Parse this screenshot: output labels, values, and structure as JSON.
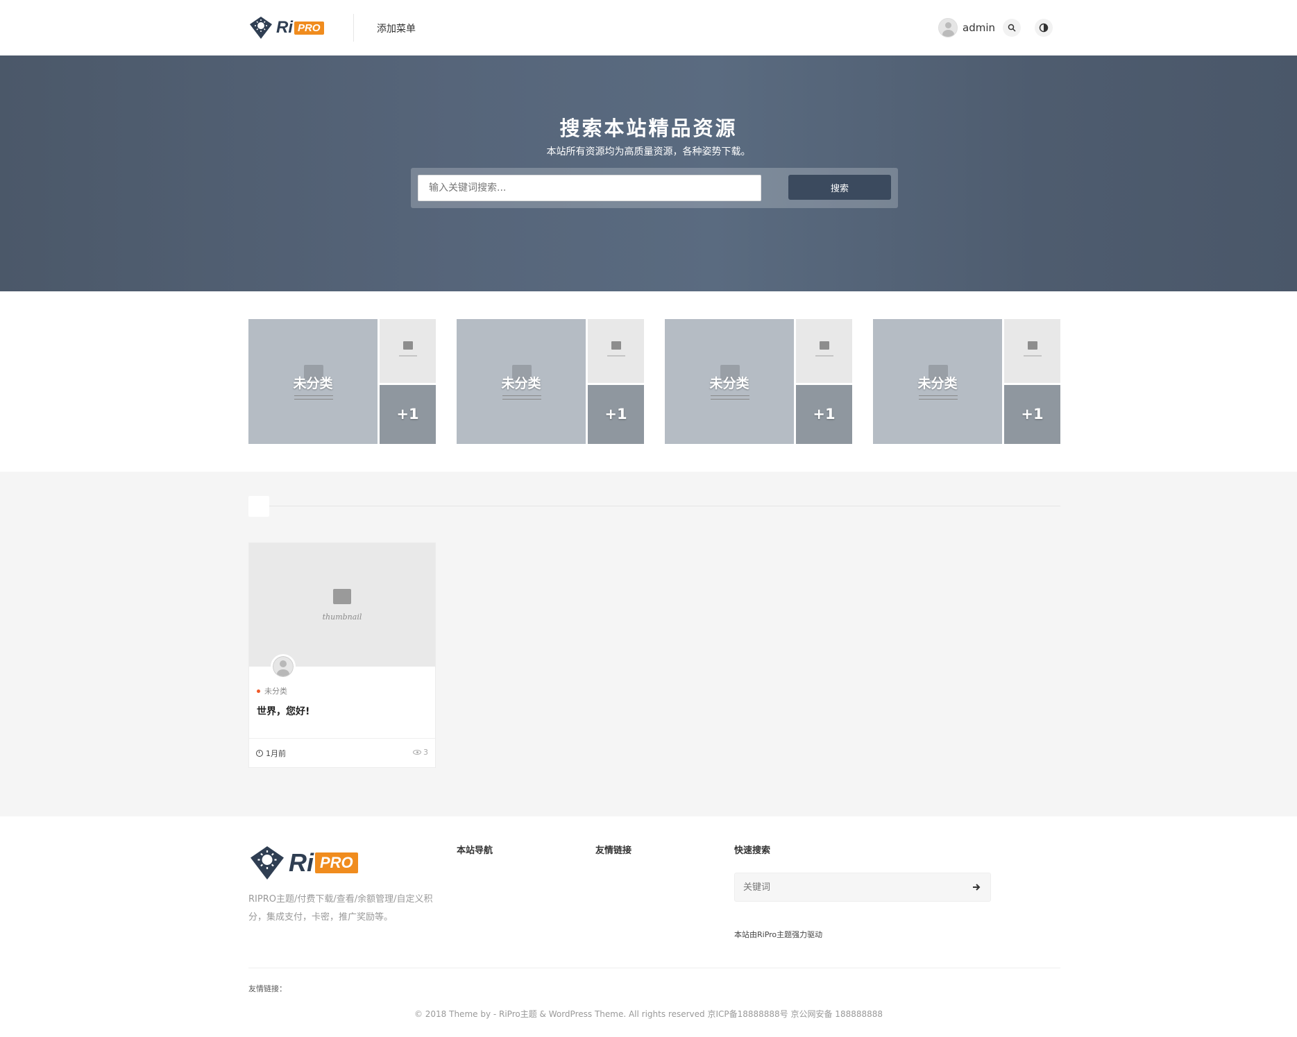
{
  "header": {
    "logo_ri": "Ri",
    "logo_pro": "PRO",
    "menu_item": "添加菜单",
    "user_name": "admin",
    "icons": [
      "search-icon",
      "theme-toggle-icon",
      "user-avatar-icon"
    ]
  },
  "hero": {
    "title": "搜索本站精品资源",
    "subtitle": "本站所有资源均为高质量资源，各种姿势下载。",
    "search_placeholder": "输入关键词搜索...",
    "search_button": "搜索"
  },
  "categories": [
    {
      "name": "未分类",
      "count": "+1"
    },
    {
      "name": "未分类",
      "count": "+1"
    },
    {
      "name": "未分类",
      "count": "+1"
    },
    {
      "name": "未分类",
      "count": "+1"
    }
  ],
  "posts": [
    {
      "thumb_text": "thumbnail",
      "category": "未分类",
      "title": "世界，您好!",
      "date": "1月前",
      "views": "3"
    }
  ],
  "footer": {
    "logo_ri": "Ri",
    "logo_pro": "PRO",
    "description": "RIPRO主题/付费下载/查看/余额管理/自定义积分，集成支付，卡密，推广奖励等。",
    "col_nav": "本站导航",
    "col_links": "友情链接",
    "col_search": "快速搜索",
    "search_placeholder": "关键词",
    "powered": "本站由RiPro主题强力驱动",
    "friend_links_label": "友情链接：",
    "copyright": "© 2018 Theme by -  RiPro主题 & WordPress Theme. All rights reserved   京ICP备18888888号   京公网安备 188888888"
  },
  "colors": {
    "accent_orange": "#f08c1e",
    "hero_bg": "#56657a",
    "button_dark": "#3b4a5e",
    "category_dot": "#f05a28"
  }
}
